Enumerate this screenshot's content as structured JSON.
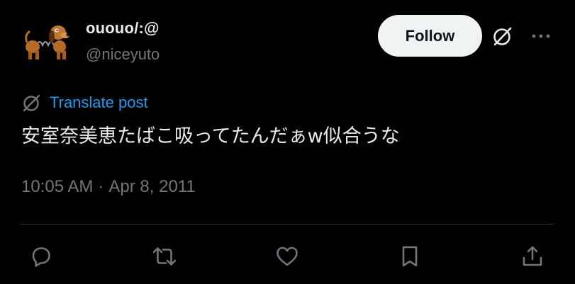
{
  "author": {
    "display_name": "ououo/:@",
    "handle": "@niceyuto"
  },
  "header": {
    "follow_label": "Follow"
  },
  "post": {
    "translate_label": "Translate post",
    "text": "安室奈美恵たばこ吸ってたんだぁw似合うな",
    "time": "10:05 AM",
    "separator": "·",
    "date": "Apr 8, 2011"
  },
  "icons": {
    "grok": "grok-icon",
    "more": "more-horizontal-icon",
    "translate": "translate-icon",
    "reply": "reply-icon",
    "repost": "repost-icon",
    "like": "like-icon",
    "bookmark": "bookmark-icon",
    "share": "share-icon"
  },
  "colors": {
    "background": "#000000",
    "primary_text": "#e7e9ea",
    "secondary_text": "#71767b",
    "link": "#1d9bf0",
    "follow_button_bg": "#eff3f4",
    "follow_button_text": "#0f1419",
    "divider": "#2f3336"
  }
}
